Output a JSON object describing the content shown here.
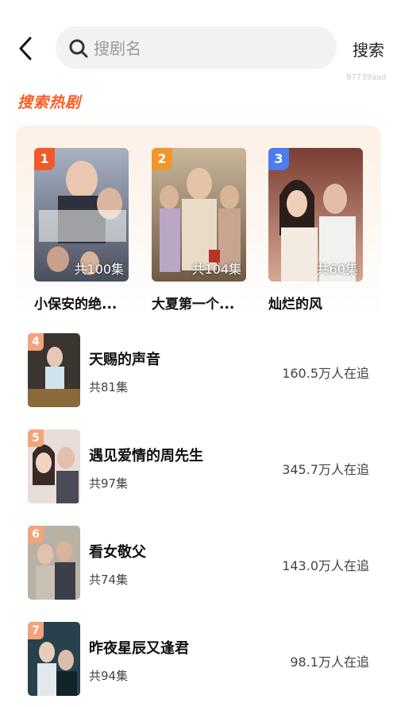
{
  "header": {
    "search_placeholder": "搜剧名",
    "search_button": "搜索",
    "user_id": "97739aad"
  },
  "section": {
    "title": "搜索热剧"
  },
  "top_dramas": [
    {
      "rank": "1",
      "episodes": "共100集",
      "title": "小保安的绝...",
      "badge_color": "#f05a2a"
    },
    {
      "rank": "2",
      "episodes": "共104集",
      "title": "大夏第一个...",
      "badge_color": "#f0962a"
    },
    {
      "rank": "3",
      "episodes": "共60集",
      "title": "灿烂的风",
      "badge_color": "#4a7df0"
    }
  ],
  "list_dramas": [
    {
      "rank": "4",
      "title": "天赐的声音",
      "episodes": "共81集",
      "followers": "160.5万人在追"
    },
    {
      "rank": "5",
      "title": "遇见爱情的周先生",
      "episodes": "共97集",
      "followers": "345.7万人在追"
    },
    {
      "rank": "6",
      "title": "看女敬父",
      "episodes": "共74集",
      "followers": "143.0万人在追"
    },
    {
      "rank": "7",
      "title": "昨夜星辰又逢君",
      "episodes": "共94集",
      "followers": "98.1万人在追"
    }
  ],
  "colors": {
    "accent": "#ff5a20",
    "list_badge": "#f5a37a"
  }
}
